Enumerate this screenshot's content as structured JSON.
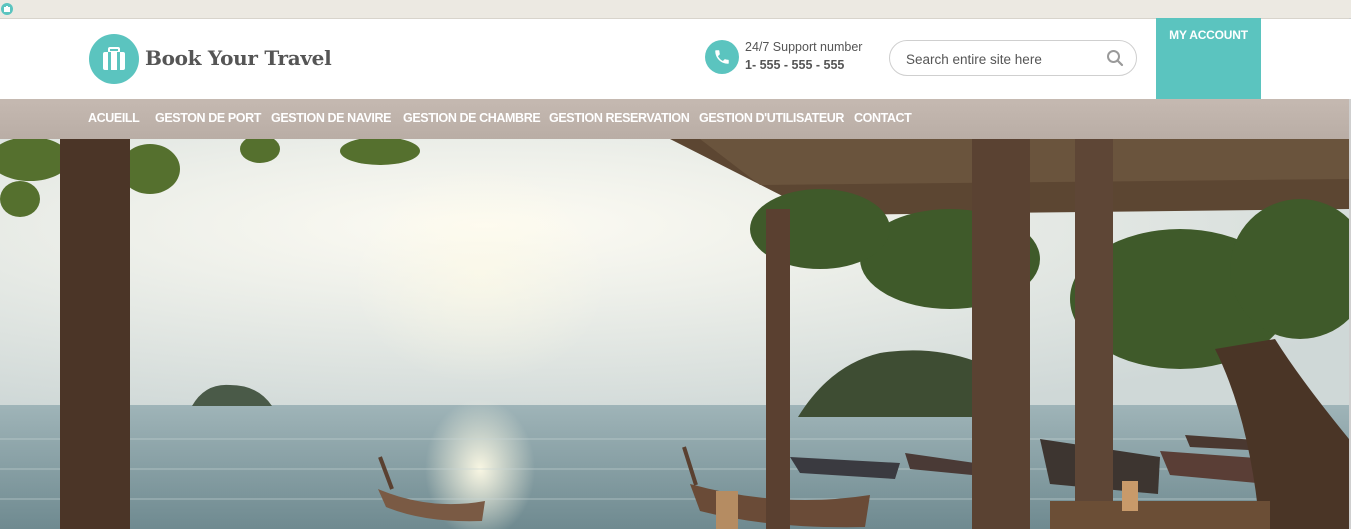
{
  "header": {
    "logo_text": "Book Your Travel",
    "support_label": "24/7 Support number",
    "support_number": "1- 555 - 555 - 555",
    "account_label": "MY ACCOUNT"
  },
  "search": {
    "placeholder": "Search entire site here"
  },
  "nav": {
    "items": [
      {
        "label": "ACUEILL"
      },
      {
        "label": "GESTON DE PORT"
      },
      {
        "label": "GESTION DE NAVIRE"
      },
      {
        "label": "GESTION DE CHAMBRE"
      },
      {
        "label": "GESTION RESERVATION"
      },
      {
        "label": "GESTION D'UTILISATEUR"
      },
      {
        "label": "CONTACT"
      }
    ]
  },
  "colors": {
    "accent": "#5bc4bf",
    "nav_bar": "#bfb3ab",
    "text": "#555555"
  },
  "icons": {
    "logo": "suitcase-icon",
    "support": "phone-icon",
    "search": "search-icon"
  }
}
